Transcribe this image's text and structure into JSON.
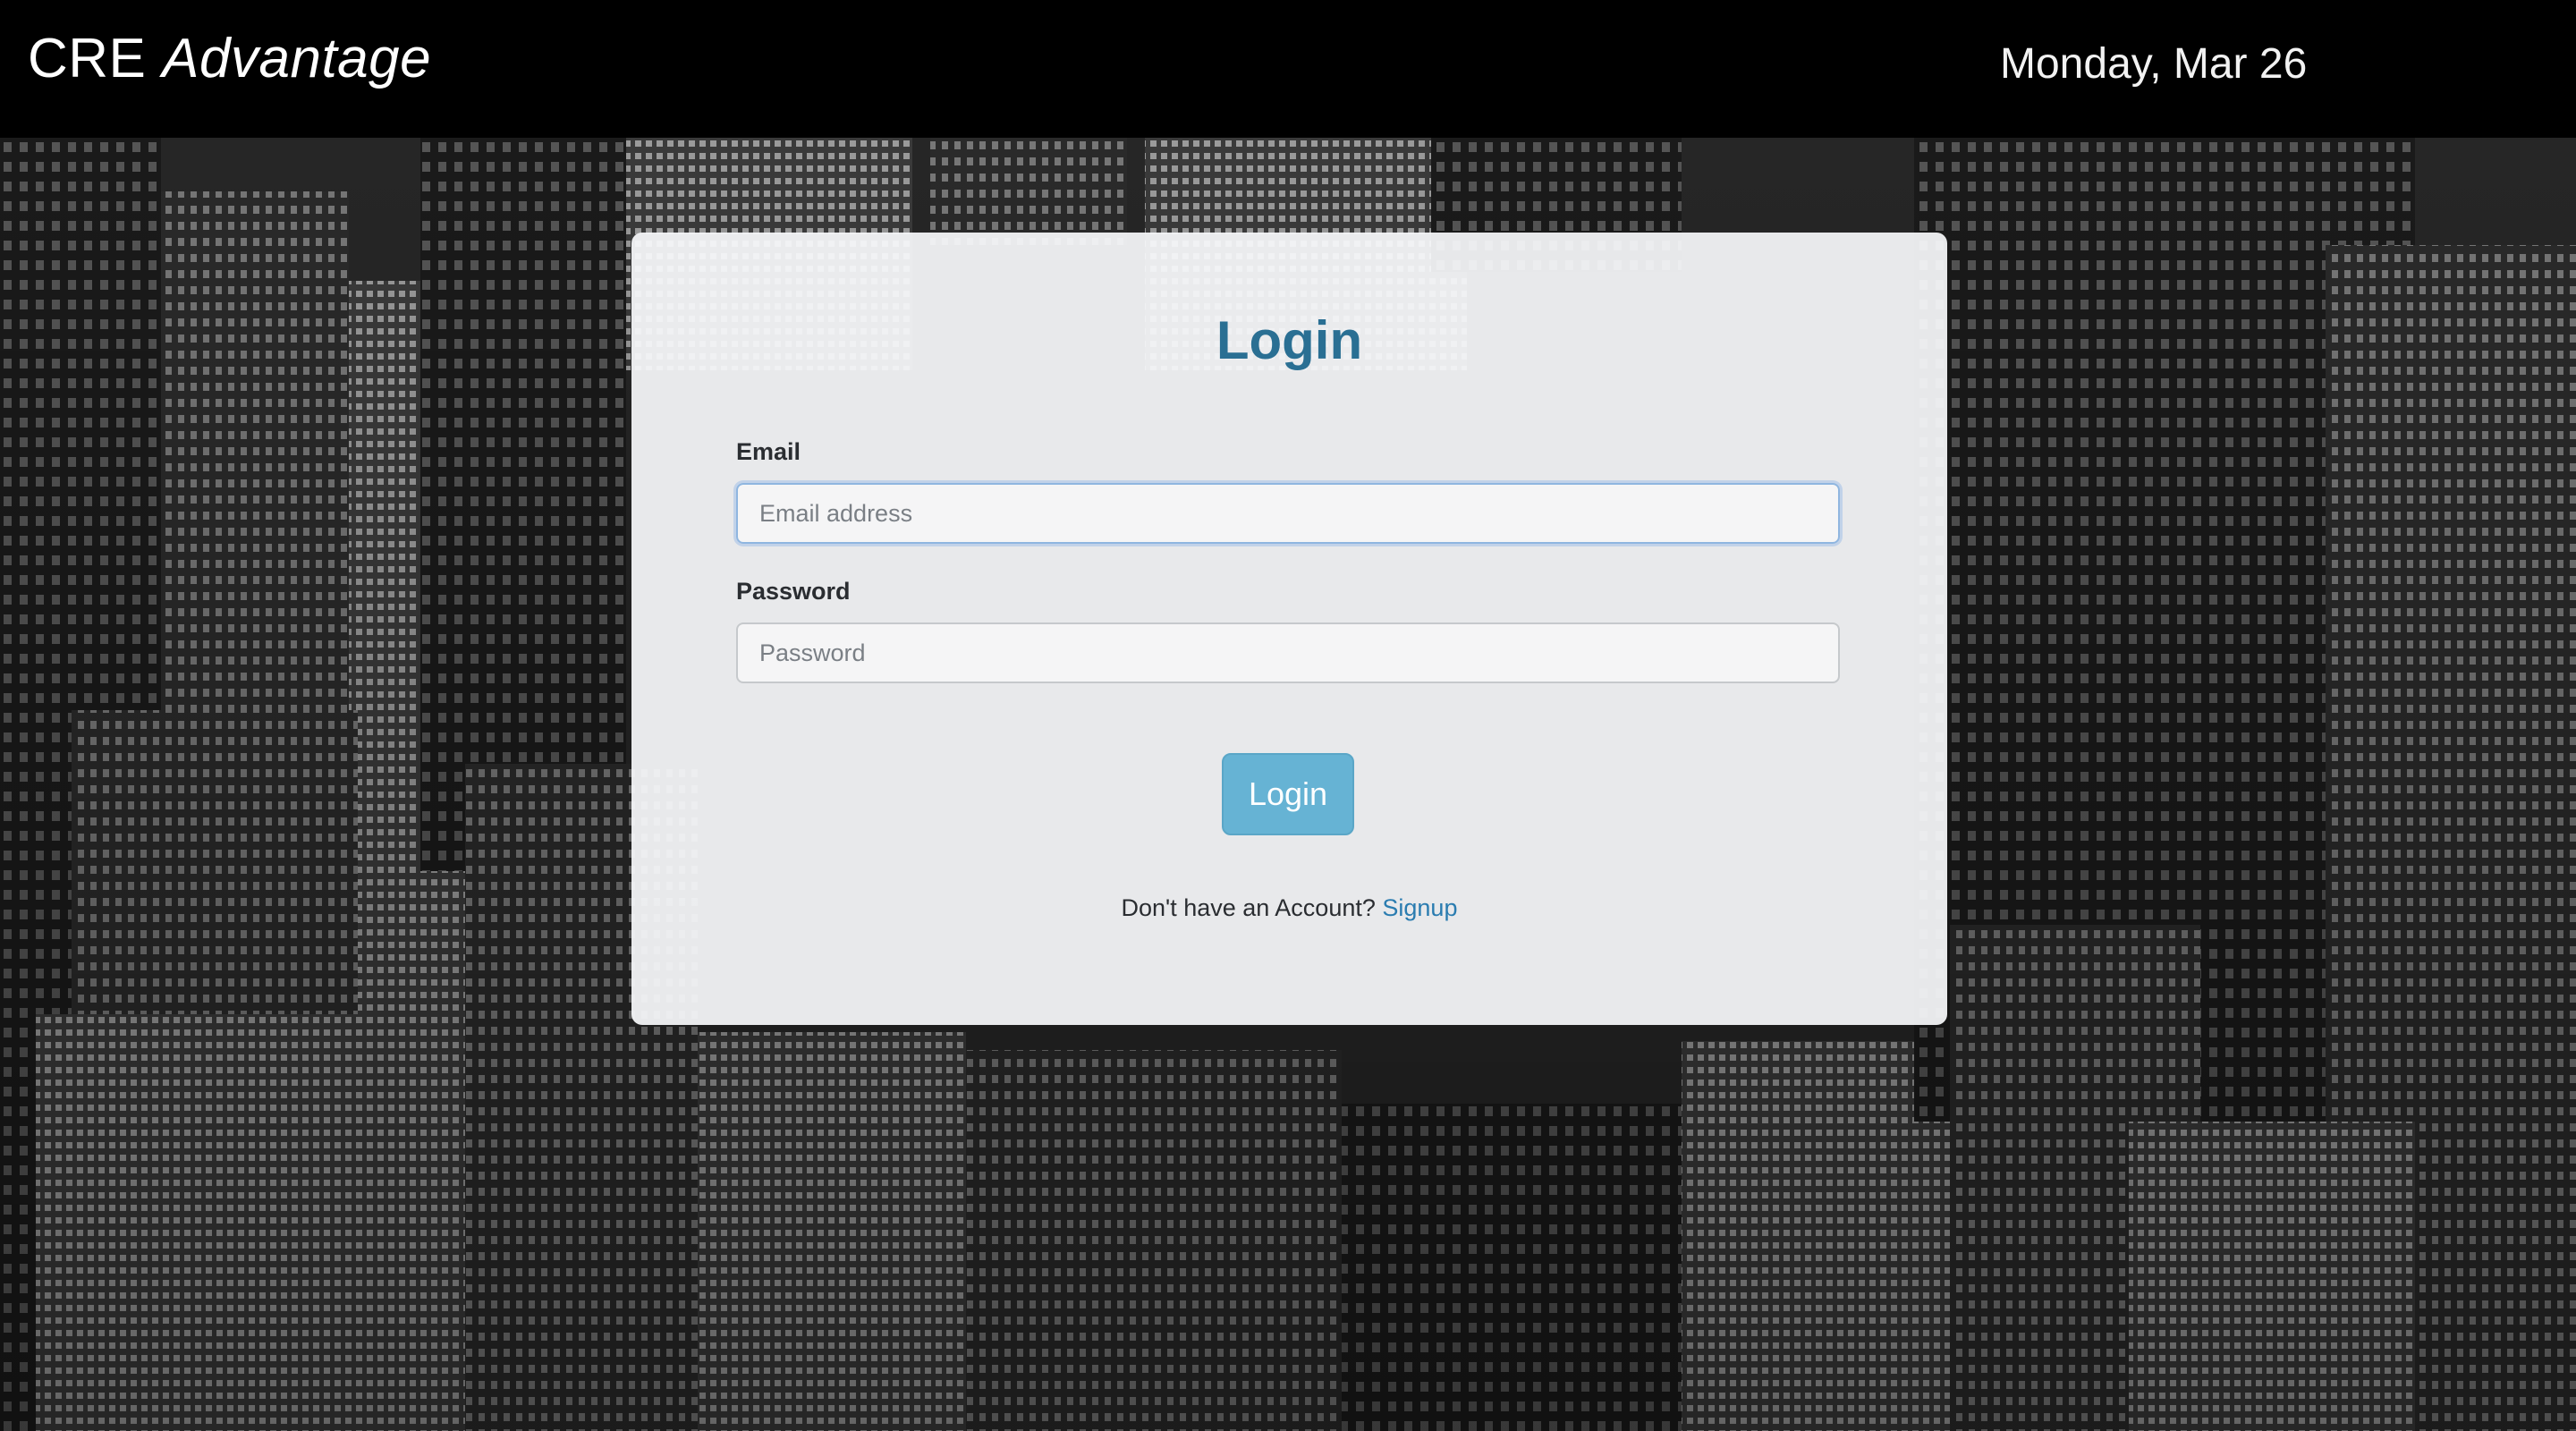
{
  "header": {
    "brand_prefix": "CRE",
    "brand_suffix": "Advantage",
    "date": "Monday, Mar 26"
  },
  "login_form": {
    "title": "Login",
    "email": {
      "label": "Email",
      "placeholder": "Email address",
      "value": ""
    },
    "password": {
      "label": "Password",
      "placeholder": "Password",
      "value": ""
    },
    "submit_label": "Login",
    "signup_prompt": "Don't have an Account?",
    "signup_link": "Signup"
  },
  "colors": {
    "header_bg": "#000000",
    "title": "#2a6f93",
    "button_bg": "#66b3d4",
    "link": "#2a7cb0",
    "focus_border": "#8fb6e0"
  },
  "icons": []
}
